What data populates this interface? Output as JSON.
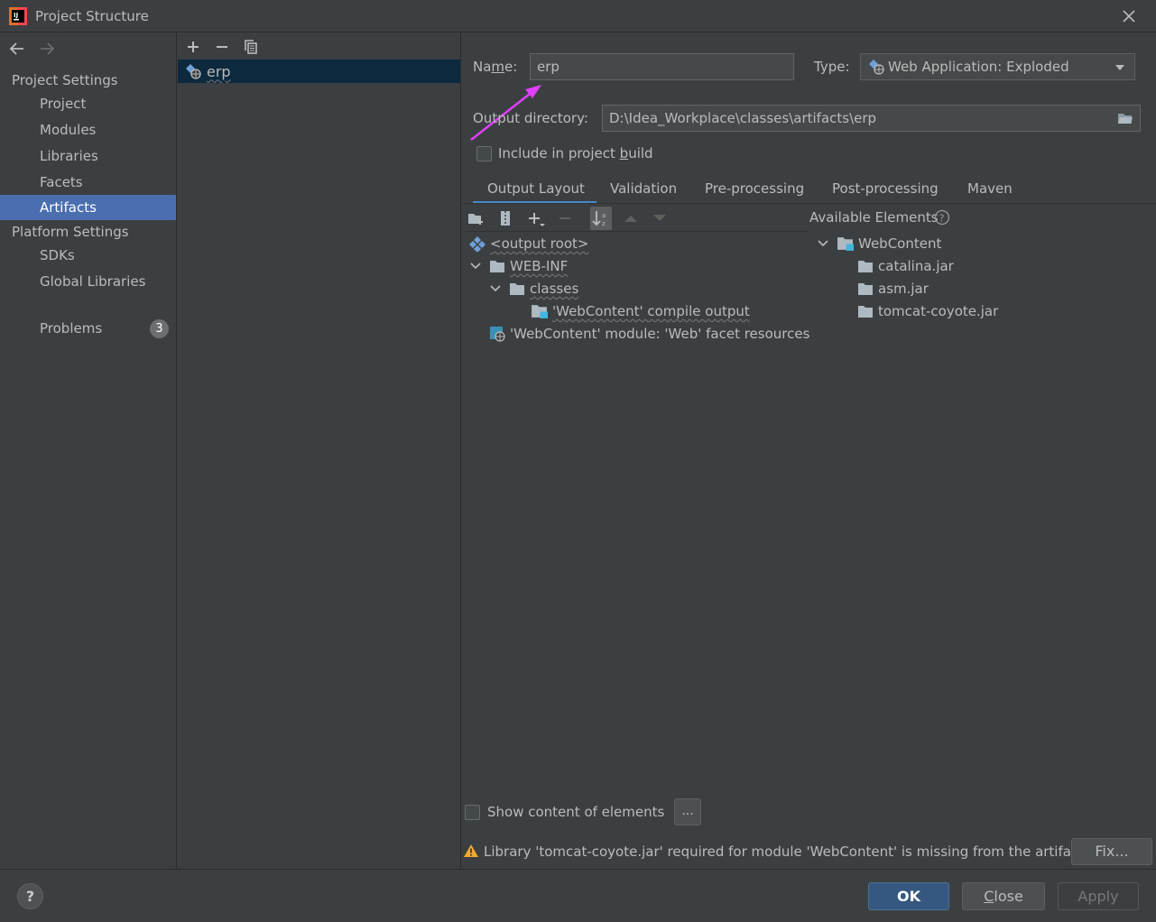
{
  "window": {
    "title": "Project Structure"
  },
  "sidebar": {
    "group_project_settings": "Project Settings",
    "group_platform_settings": "Platform Settings",
    "items": [
      {
        "label": "Project"
      },
      {
        "label": "Modules"
      },
      {
        "label": "Libraries"
      },
      {
        "label": "Facets"
      },
      {
        "label": "Artifacts",
        "selected": true
      },
      {
        "label": "SDKs"
      },
      {
        "label": "Global Libraries"
      },
      {
        "label": "Problems",
        "badge": "3"
      }
    ]
  },
  "artifacts_list": {
    "items": [
      {
        "label": "erp",
        "icon": "web-artifact-icon"
      }
    ]
  },
  "form": {
    "name_label_pre": "Na",
    "name_label_mnemonic": "m",
    "name_label_post": "e:",
    "name_value": "erp",
    "type_label": "Type:",
    "type_value": "Web Application: Exploded",
    "output_label": "Output directory:",
    "output_value": "D:\\Idea_Workplace\\classes\\artifacts\\erp",
    "include_label_pre": "Include in project ",
    "include_label_mnemonic": "b",
    "include_label_post": "uild",
    "include_checked": false
  },
  "tabs": [
    {
      "label": "Output Layout",
      "active": true
    },
    {
      "label": "Validation"
    },
    {
      "label": "Pre-processing"
    },
    {
      "label": "Post-processing"
    },
    {
      "label": "Maven"
    }
  ],
  "output_tree": [
    {
      "label": "<output root>",
      "icon": "artifact-root-icon"
    },
    {
      "label": "WEB-INF",
      "icon": "folder-icon",
      "expanded": true
    },
    {
      "label": "classes",
      "icon": "folder-icon",
      "expanded": true
    },
    {
      "label": "'WebContent' compile output",
      "icon": "module-output-icon"
    },
    {
      "label": "'WebContent' module: 'Web' facet resources",
      "icon": "web-facet-icon"
    }
  ],
  "available": {
    "title": "Available Elements",
    "items": [
      {
        "label": "WebContent",
        "icon": "module-folder-icon",
        "expanded": true
      },
      {
        "label": "catalina.jar",
        "icon": "folder-icon"
      },
      {
        "label": "asm.jar",
        "icon": "folder-icon"
      },
      {
        "label": "tomcat-coyote.jar",
        "icon": "folder-icon"
      }
    ]
  },
  "show_content": {
    "label": "Show content of elements",
    "checked": false,
    "more_button": "..."
  },
  "warning": {
    "text": "Library 'tomcat-coyote.jar' required for module 'WebContent' is missing from the artifact",
    "fix_button": "Fix..."
  },
  "footer": {
    "help": "?",
    "ok": "OK",
    "close_mnemonic": "C",
    "close_rest": "lose",
    "apply": "Apply"
  },
  "colors": {
    "background": "#3c3f41",
    "selection": "#4b6eaf",
    "tab_underline": "#4a88c7",
    "annotation_arrow": "#e040fb",
    "warning": "#f0a732",
    "folder": "#aeb9c0",
    "module_blue": "#40b6e0"
  }
}
